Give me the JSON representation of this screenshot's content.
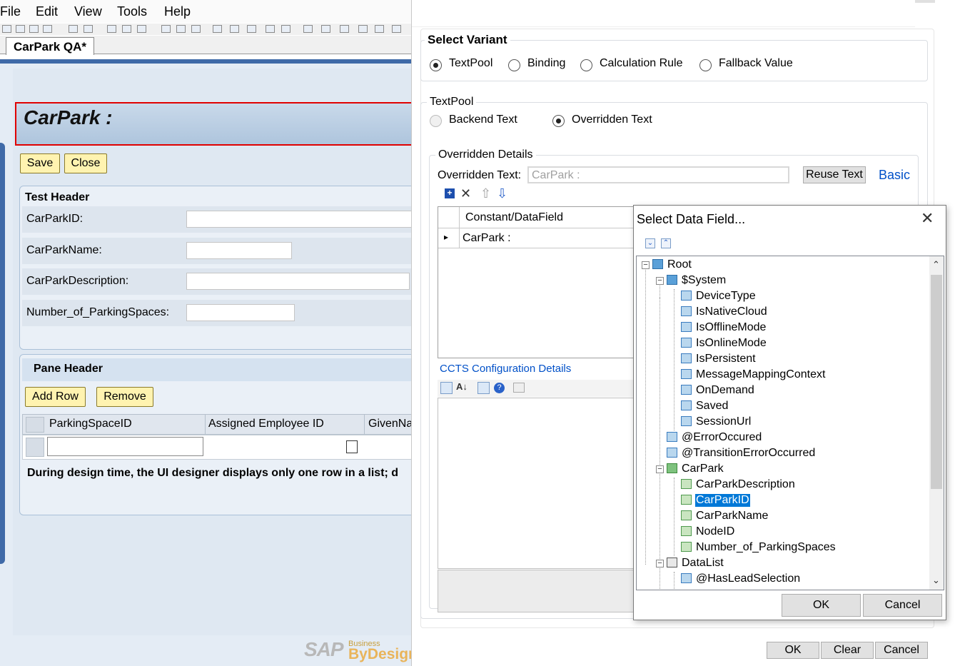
{
  "designer": {
    "menu": [
      "File",
      "Edit",
      "View",
      "Tools",
      "Help"
    ],
    "tab_title": "CarPark QA*",
    "page_title": "CarPark :",
    "save_label": "Save",
    "close_label": "Close",
    "test_header": "Test Header",
    "fields": [
      "CarParkID:",
      "CarParkName:",
      "CarParkDescription:",
      "Number_of_ParkingSpaces:"
    ],
    "pane_header": "Pane Header",
    "add_row_label": "Add Row",
    "remove_label": "Remove",
    "grid_columns": [
      "ParkingSpaceID",
      "Assigned Employee ID",
      "GivenNa"
    ],
    "footnote": "During design time, the UI designer displays only one row in a list; d",
    "logo_text": "SAP",
    "logo_business": "Business",
    "logo_bydesign": "ByDesign"
  },
  "variant_dialog": {
    "select_variant_title": "Select Variant",
    "variant_options": [
      "TextPool",
      "Binding",
      "Calculation Rule",
      "Fallback Value"
    ],
    "variant_selected": "TextPool",
    "textpool_title": "TextPool",
    "textpool_options": [
      "Backend Text",
      "Overridden Text"
    ],
    "textpool_selected": "Overridden Text",
    "overridden_details_title": "Overridden Details",
    "overridden_text_label": "Overridden Text:",
    "overridden_text_value": "CarPark :",
    "reuse_text_label": "Reuse Text",
    "basic_link": "Basic",
    "table_header": "Constant/DataField",
    "table_rows": [
      "CarPark :"
    ],
    "ccts_link": "CCTS Configuration Details",
    "ok_label": "OK",
    "clear_label": "Clear",
    "cancel_label": "Cancel"
  },
  "select_data_field": {
    "title": "Select Data Field...",
    "ok_label": "OK",
    "cancel_label": "Cancel",
    "tree": {
      "root": "Root",
      "system": "$System",
      "system_items": [
        "DeviceType",
        "IsNativeCloud",
        "IsOfflineMode",
        "IsOnlineMode",
        "IsPersistent",
        "MessageMappingContext",
        "OnDemand",
        "Saved",
        "SessionUrl"
      ],
      "root_items": [
        "@ErrorOccured",
        "@TransitionErrorOccurred"
      ],
      "carpark": "CarPark",
      "carpark_items": [
        "CarParkDescription",
        "CarParkID",
        "CarParkName",
        "NodeID",
        "Number_of_ParkingSpaces"
      ],
      "selected": "CarParkID",
      "datalist": "DataList",
      "datalist_items": [
        "@HasLeadSelection"
      ]
    }
  },
  "colors": {
    "accent_blue": "#0078d7",
    "link_blue": "#0050c8",
    "title_border": "#e00000",
    "yellow_button": "#fff3b0"
  }
}
